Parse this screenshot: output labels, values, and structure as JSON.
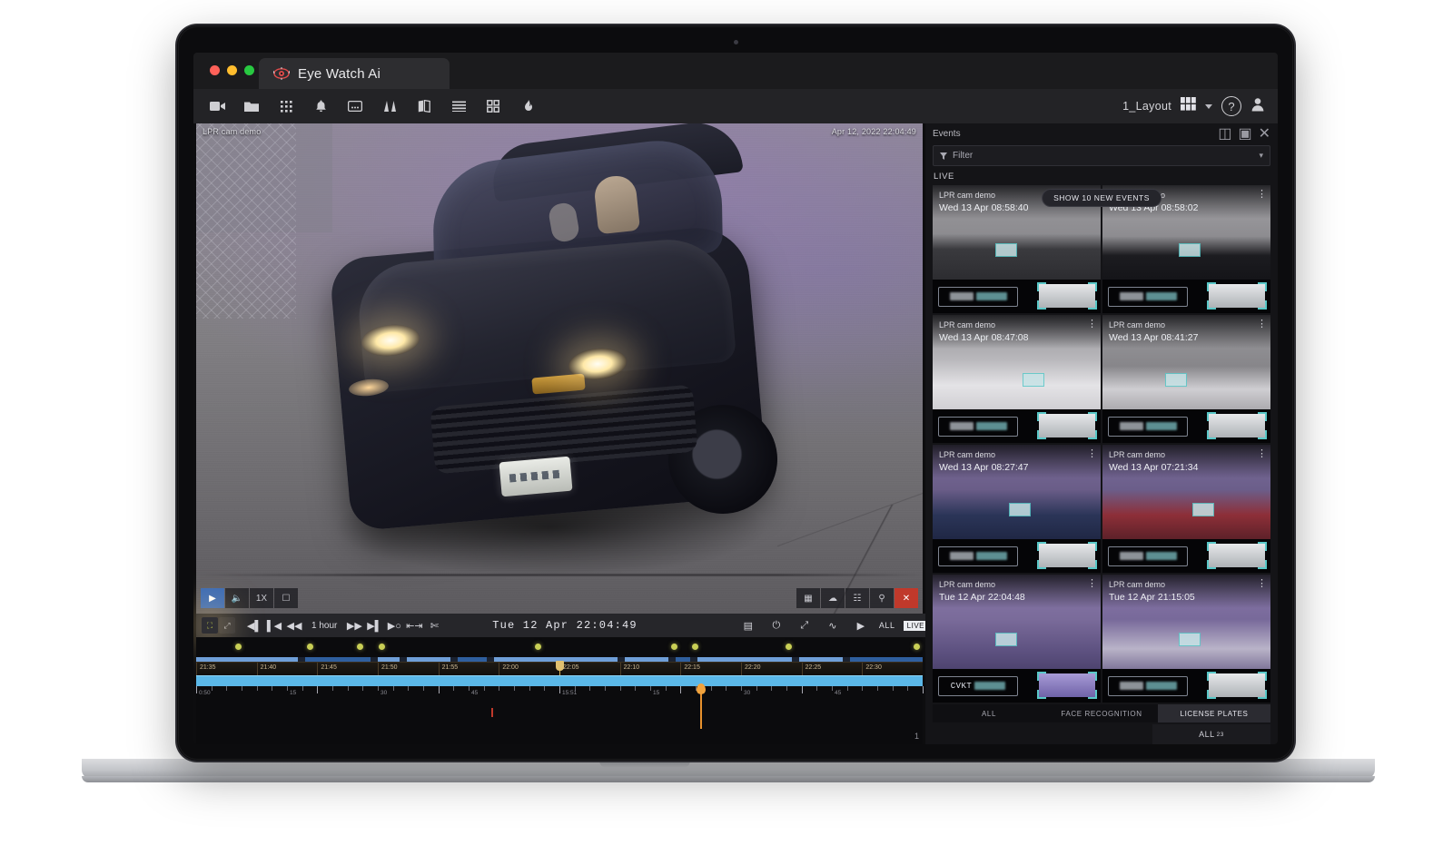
{
  "app": {
    "tab_title": "Eye Watch Ai",
    "tab_icon": "eye-logo-icon",
    "traffic_lights": [
      "close",
      "minimize",
      "zoom"
    ]
  },
  "toolbar": {
    "buttons": [
      {
        "name": "cameras",
        "icon": "video-camera-icon"
      },
      {
        "name": "resources",
        "icon": "folder-icon"
      },
      {
        "name": "layouts",
        "icon": "grid-dots-icon"
      },
      {
        "name": "notifications",
        "icon": "bell-icon"
      },
      {
        "name": "bookmarks",
        "icon": "bookmark-card-icon"
      },
      {
        "name": "analytics",
        "icon": "chart-columns-icon"
      },
      {
        "name": "map",
        "icon": "map-icon"
      },
      {
        "name": "list",
        "icon": "list-lines-icon"
      },
      {
        "name": "tiles",
        "icon": "four-squares-icon"
      },
      {
        "name": "flame",
        "icon": "flame-icon"
      }
    ],
    "layout_label": "1_Layout",
    "layout_icon": "layout-grid-icon",
    "dropdown_icon": "chevron-down-icon",
    "help_label": "?",
    "help_icon": "help-circle-icon",
    "user_icon": "user-avatar-icon"
  },
  "video": {
    "camera_label": "LPR cam demo",
    "timestamp": "Apr 12, 2022 22:04:49",
    "controls_left": [
      {
        "name": "play",
        "icon": "play-icon",
        "active": true
      },
      {
        "name": "mute",
        "icon": "speaker-mute-icon",
        "active": false
      },
      {
        "name": "speed",
        "icon": "1X",
        "active": false
      },
      {
        "name": "ptz",
        "icon": "ptz-frame-icon",
        "active": false
      }
    ],
    "controls_right": [
      {
        "name": "screenshot",
        "icon": "image-icon"
      },
      {
        "name": "smart-search",
        "icon": "cloud-icon"
      },
      {
        "name": "zoom-window",
        "icon": "grid-zoom-icon"
      },
      {
        "name": "search",
        "icon": "magnifier-icon"
      },
      {
        "name": "close",
        "icon": "close-x-icon"
      }
    ]
  },
  "playback": {
    "left_group": [
      {
        "name": "sound",
        "icon": "speaker-icon",
        "highlight": false
      },
      {
        "name": "motion",
        "icon": "car-icon",
        "highlight": true
      },
      {
        "name": "sync",
        "icon": "sync-icon",
        "highlight": false
      }
    ],
    "buttons": [
      {
        "name": "jump-to-start",
        "icon": "skip-start-icon"
      },
      {
        "name": "previous-chunk",
        "icon": "prev-chunk-icon"
      },
      {
        "name": "rewind",
        "icon": "rewind-icon"
      }
    ],
    "duration_label": "1 hour",
    "buttons_right": [
      {
        "name": "fast-forward",
        "icon": "fast-forward-icon"
      },
      {
        "name": "next-chunk",
        "icon": "next-chunk-icon"
      },
      {
        "name": "jump-to-end",
        "icon": "skip-end-icon"
      },
      {
        "name": "mark-in-out",
        "icon": "mark-selection-icon"
      },
      {
        "name": "cut",
        "icon": "scissors-icon"
      }
    ],
    "current_time": "Tue  12  Apr   22:04:49",
    "right_buttons": [
      {
        "name": "calendar",
        "icon": "calendar-icon"
      },
      {
        "name": "expand",
        "icon": "expand-corners-icon"
      },
      {
        "name": "fullscreen",
        "icon": "fullscreen-icon"
      },
      {
        "name": "motion-graph",
        "icon": "pulse-icon"
      },
      {
        "name": "play",
        "icon": "play-triangle-icon"
      }
    ],
    "all_label": "ALL",
    "live_badge": "LIVE"
  },
  "timeline": {
    "ruler_labels": [
      "21:35",
      "21:40",
      "21:45",
      "21:50",
      "21:55",
      "22:00",
      "22:05",
      "22:10",
      "22:15",
      "22:20",
      "22:25",
      "22:30"
    ],
    "sub_ruler_labels": [
      "0:50",
      "15",
      "30",
      "45",
      "15:51",
      "15",
      "30",
      "45"
    ],
    "event_marker_positions": [
      5,
      15,
      22,
      25,
      47,
      66,
      69,
      82,
      100
    ],
    "page_number": "1"
  },
  "events": {
    "panel_title": "Events",
    "header_icons": [
      {
        "name": "new-tab",
        "icon": "new-tab-icon"
      },
      {
        "name": "panel-toggle",
        "icon": "panel-toggle-icon"
      },
      {
        "name": "close-panel",
        "icon": "close-x-icon"
      }
    ],
    "filter": {
      "icon": "funnel-icon",
      "placeholder": "Filter",
      "value": "Filter",
      "caret_icon": "caret-icon"
    },
    "section_label": "LIVE",
    "new_events_banner": "SHOW 10 NEW EVENTS",
    "cards": [
      {
        "camera": "LPR cam demo",
        "time": "Wed 13 Apr 08:58:40",
        "vehicle": "jeep-front",
        "plate_tone": "#8d9298"
      },
      {
        "camera": "LPR cam demo",
        "time": "Wed 13 Apr 08:58:02",
        "vehicle": "black-sedan-rear",
        "plate_tone": "#8d9298"
      },
      {
        "camera": "LPR cam demo",
        "time": "Wed 13 Apr 08:47:08",
        "vehicle": "white-sedan-front",
        "plate_tone": "#8d9298"
      },
      {
        "camera": "LPR cam demo",
        "time": "Wed 13 Apr 08:41:27",
        "vehicle": "grey-car-rear",
        "plate_tone": "#8d9298"
      },
      {
        "camera": "LPR cam demo",
        "time": "Wed 13 Apr 08:27:47",
        "vehicle": "blue-car-night",
        "plate_tone": "#8d9298"
      },
      {
        "camera": "LPR cam demo",
        "time": "Wed 13 Apr 07:21:34",
        "vehicle": "red-car-night",
        "plate_tone": "#8d9298"
      },
      {
        "camera": "LPR cam demo",
        "time": "Tue 12 Apr 22:04:48",
        "vehicle": "purple-plate-car",
        "plate_text": "CVKT",
        "plate_tone": "#9aa0c8"
      },
      {
        "camera": "LPR cam demo",
        "time": "Tue 12 Apr 21:15:05",
        "vehicle": "white-plate-car",
        "plate_tone": "#8d9298"
      }
    ],
    "tabs": [
      {
        "label": "ALL",
        "active": false
      },
      {
        "label": "FACE RECOGNITION",
        "active": false
      },
      {
        "label": "LICENSE PLATES",
        "active": true
      }
    ],
    "all_label": "ALL",
    "all_count": "23"
  },
  "colors": {
    "accent": "#5bb8e8",
    "playhead": "#e8922d",
    "marker": "#c9cf55",
    "close": "#c0392b",
    "active_blue": "#3b6bb5",
    "detect_box": "#59c8c8"
  }
}
